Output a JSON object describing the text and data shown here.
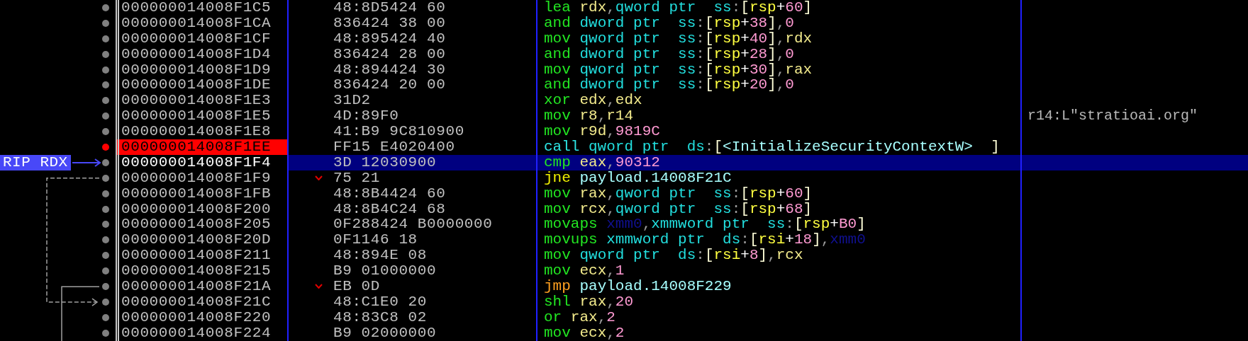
{
  "rows": [
    {
      "address": "000000014008F1C5",
      "bytes": "48:8D5424 60",
      "breakpoint": false,
      "selected": false,
      "jump": false,
      "instruction": [
        {
          "text": "lea ",
          "kind": "mnemonic"
        },
        {
          "text": "rdx",
          "kind": "register"
        },
        {
          "text": ",",
          "kind": "sep"
        },
        {
          "text": "qword ptr  ",
          "kind": "size"
        },
        {
          "text": "ss",
          "kind": "segment"
        },
        {
          "text": ":",
          "kind": "sep"
        },
        {
          "text": "[",
          "kind": "bracket"
        },
        {
          "text": "rsp",
          "kind": "memreg"
        },
        {
          "text": "+",
          "kind": "op"
        },
        {
          "text": "60",
          "kind": "number"
        },
        {
          "text": "]",
          "kind": "bracket"
        }
      ]
    },
    {
      "address": "000000014008F1CA",
      "bytes": "836424 38 00",
      "breakpoint": false,
      "selected": false,
      "jump": false,
      "instruction": [
        {
          "text": "and ",
          "kind": "mnemonic"
        },
        {
          "text": "dword ptr  ",
          "kind": "size"
        },
        {
          "text": "ss",
          "kind": "segment"
        },
        {
          "text": ":",
          "kind": "sep"
        },
        {
          "text": "[",
          "kind": "bracket"
        },
        {
          "text": "rsp",
          "kind": "memreg"
        },
        {
          "text": "+",
          "kind": "op"
        },
        {
          "text": "38",
          "kind": "number"
        },
        {
          "text": "]",
          "kind": "bracket"
        },
        {
          "text": ",",
          "kind": "sep"
        },
        {
          "text": "0",
          "kind": "number"
        }
      ]
    },
    {
      "address": "000000014008F1CF",
      "bytes": "48:895424 40",
      "breakpoint": false,
      "selected": false,
      "jump": false,
      "instruction": [
        {
          "text": "mov ",
          "kind": "mnemonic"
        },
        {
          "text": "qword ptr  ",
          "kind": "size"
        },
        {
          "text": "ss",
          "kind": "segment"
        },
        {
          "text": ":",
          "kind": "sep"
        },
        {
          "text": "[",
          "kind": "bracket"
        },
        {
          "text": "rsp",
          "kind": "memreg"
        },
        {
          "text": "+",
          "kind": "op"
        },
        {
          "text": "40",
          "kind": "number"
        },
        {
          "text": "]",
          "kind": "bracket"
        },
        {
          "text": ",",
          "kind": "sep"
        },
        {
          "text": "rdx",
          "kind": "register"
        }
      ]
    },
    {
      "address": "000000014008F1D4",
      "bytes": "836424 28 00",
      "breakpoint": false,
      "selected": false,
      "jump": false,
      "instruction": [
        {
          "text": "and ",
          "kind": "mnemonic"
        },
        {
          "text": "dword ptr  ",
          "kind": "size"
        },
        {
          "text": "ss",
          "kind": "segment"
        },
        {
          "text": ":",
          "kind": "sep"
        },
        {
          "text": "[",
          "kind": "bracket"
        },
        {
          "text": "rsp",
          "kind": "memreg"
        },
        {
          "text": "+",
          "kind": "op"
        },
        {
          "text": "28",
          "kind": "number"
        },
        {
          "text": "]",
          "kind": "bracket"
        },
        {
          "text": ",",
          "kind": "sep"
        },
        {
          "text": "0",
          "kind": "number"
        }
      ]
    },
    {
      "address": "000000014008F1D9",
      "bytes": "48:894424 30",
      "breakpoint": false,
      "selected": false,
      "jump": false,
      "instruction": [
        {
          "text": "mov ",
          "kind": "mnemonic"
        },
        {
          "text": "qword ptr  ",
          "kind": "size"
        },
        {
          "text": "ss",
          "kind": "segment"
        },
        {
          "text": ":",
          "kind": "sep"
        },
        {
          "text": "[",
          "kind": "bracket"
        },
        {
          "text": "rsp",
          "kind": "memreg"
        },
        {
          "text": "+",
          "kind": "op"
        },
        {
          "text": "30",
          "kind": "number"
        },
        {
          "text": "]",
          "kind": "bracket"
        },
        {
          "text": ",",
          "kind": "sep"
        },
        {
          "text": "rax",
          "kind": "register"
        }
      ]
    },
    {
      "address": "000000014008F1DE",
      "bytes": "836424 20 00",
      "breakpoint": false,
      "selected": false,
      "jump": false,
      "instruction": [
        {
          "text": "and ",
          "kind": "mnemonic"
        },
        {
          "text": "dword ptr  ",
          "kind": "size"
        },
        {
          "text": "ss",
          "kind": "segment"
        },
        {
          "text": ":",
          "kind": "sep"
        },
        {
          "text": "[",
          "kind": "bracket"
        },
        {
          "text": "rsp",
          "kind": "memreg"
        },
        {
          "text": "+",
          "kind": "op"
        },
        {
          "text": "20",
          "kind": "number"
        },
        {
          "text": "]",
          "kind": "bracket"
        },
        {
          "text": ",",
          "kind": "sep"
        },
        {
          "text": "0",
          "kind": "number"
        }
      ]
    },
    {
      "address": "000000014008F1E3",
      "bytes": "31D2",
      "breakpoint": false,
      "selected": false,
      "jump": false,
      "instruction": [
        {
          "text": "xor ",
          "kind": "mnemonic"
        },
        {
          "text": "edx",
          "kind": "register"
        },
        {
          "text": ",",
          "kind": "sep"
        },
        {
          "text": "edx",
          "kind": "register"
        }
      ]
    },
    {
      "address": "000000014008F1E5",
      "bytes": "4D:89F0",
      "breakpoint": false,
      "selected": false,
      "jump": false,
      "instruction": [
        {
          "text": "mov ",
          "kind": "mnemonic"
        },
        {
          "text": "r8",
          "kind": "register"
        },
        {
          "text": ",",
          "kind": "sep"
        },
        {
          "text": "r14",
          "kind": "register"
        }
      ],
      "comment": "r14:L\"stratioai.org\""
    },
    {
      "address": "000000014008F1E8",
      "bytes": "41:B9 9C810900",
      "breakpoint": false,
      "selected": false,
      "jump": false,
      "instruction": [
        {
          "text": "mov ",
          "kind": "mnemonic"
        },
        {
          "text": "r9d",
          "kind": "register"
        },
        {
          "text": ",",
          "kind": "sep"
        },
        {
          "text": "9819C",
          "kind": "number"
        }
      ]
    },
    {
      "address": "000000014008F1EE",
      "bytes": "FF15 E4020400",
      "breakpoint": true,
      "selected": false,
      "jump": false,
      "instruction": [
        {
          "text": "call ",
          "kind": "call"
        },
        {
          "text": "qword ptr  ",
          "kind": "size"
        },
        {
          "text": "ds",
          "kind": "segment"
        },
        {
          "text": ":",
          "kind": "sep"
        },
        {
          "text": "[",
          "kind": "bracket"
        },
        {
          "text": "<InitializeSecurityContextW>  ",
          "kind": "label"
        },
        {
          "text": "]",
          "kind": "bracket"
        }
      ]
    },
    {
      "address": "000000014008F1F4",
      "bytes": "3D 12030900",
      "breakpoint": false,
      "selected": true,
      "jump": false,
      "register_label": "RIP RDX",
      "instruction": [
        {
          "text": "cmp ",
          "kind": "mnemonic"
        },
        {
          "text": "eax",
          "kind": "register"
        },
        {
          "text": ",",
          "kind": "sep"
        },
        {
          "text": "90312",
          "kind": "number"
        }
      ]
    },
    {
      "address": "000000014008F1F9",
      "bytes": "75 21",
      "breakpoint": false,
      "selected": false,
      "jump": true,
      "instruction": [
        {
          "text": "jne ",
          "kind": "jcc"
        },
        {
          "text": "payload.14008F21C",
          "kind": "label"
        }
      ]
    },
    {
      "address": "000000014008F1FB",
      "bytes": "48:8B4424 60",
      "breakpoint": false,
      "selected": false,
      "jump": false,
      "instruction": [
        {
          "text": "mov ",
          "kind": "mnemonic"
        },
        {
          "text": "rax",
          "kind": "register"
        },
        {
          "text": ",",
          "kind": "sep"
        },
        {
          "text": "qword ptr  ",
          "kind": "size"
        },
        {
          "text": "ss",
          "kind": "segment"
        },
        {
          "text": ":",
          "kind": "sep"
        },
        {
          "text": "[",
          "kind": "bracket"
        },
        {
          "text": "rsp",
          "kind": "memreg"
        },
        {
          "text": "+",
          "kind": "op"
        },
        {
          "text": "60",
          "kind": "number"
        },
        {
          "text": "]",
          "kind": "bracket"
        }
      ]
    },
    {
      "address": "000000014008F200",
      "bytes": "48:8B4C24 68",
      "breakpoint": false,
      "selected": false,
      "jump": false,
      "instruction": [
        {
          "text": "mov ",
          "kind": "mnemonic"
        },
        {
          "text": "rcx",
          "kind": "register"
        },
        {
          "text": ",",
          "kind": "sep"
        },
        {
          "text": "qword ptr  ",
          "kind": "size"
        },
        {
          "text": "ss",
          "kind": "segment"
        },
        {
          "text": ":",
          "kind": "sep"
        },
        {
          "text": "[",
          "kind": "bracket"
        },
        {
          "text": "rsp",
          "kind": "memreg"
        },
        {
          "text": "+",
          "kind": "op"
        },
        {
          "text": "68",
          "kind": "number"
        },
        {
          "text": "]",
          "kind": "bracket"
        }
      ]
    },
    {
      "address": "000000014008F205",
      "bytes": "0F288424 B0000000",
      "breakpoint": false,
      "selected": false,
      "jump": false,
      "instruction": [
        {
          "text": "movaps ",
          "kind": "mnemonic"
        },
        {
          "text": "xmm0",
          "kind": "xmm"
        },
        {
          "text": ",",
          "kind": "sep"
        },
        {
          "text": "xmmword ptr  ",
          "kind": "size"
        },
        {
          "text": "ss",
          "kind": "segment"
        },
        {
          "text": ":",
          "kind": "sep"
        },
        {
          "text": "[",
          "kind": "bracket"
        },
        {
          "text": "rsp",
          "kind": "memreg"
        },
        {
          "text": "+",
          "kind": "op"
        },
        {
          "text": "B0",
          "kind": "number"
        },
        {
          "text": "]",
          "kind": "bracket"
        }
      ]
    },
    {
      "address": "000000014008F20D",
      "bytes": "0F1146 18",
      "breakpoint": false,
      "selected": false,
      "jump": false,
      "instruction": [
        {
          "text": "movups ",
          "kind": "mnemonic"
        },
        {
          "text": "xmmword ptr  ",
          "kind": "size"
        },
        {
          "text": "ds",
          "kind": "segment"
        },
        {
          "text": ":",
          "kind": "sep"
        },
        {
          "text": "[",
          "kind": "bracket"
        },
        {
          "text": "rsi",
          "kind": "memreg"
        },
        {
          "text": "+",
          "kind": "op"
        },
        {
          "text": "18",
          "kind": "number"
        },
        {
          "text": "]",
          "kind": "bracket"
        },
        {
          "text": ",",
          "kind": "sep"
        },
        {
          "text": "xmm0",
          "kind": "xmm"
        }
      ]
    },
    {
      "address": "000000014008F211",
      "bytes": "48:894E 08",
      "breakpoint": false,
      "selected": false,
      "jump": false,
      "instruction": [
        {
          "text": "mov ",
          "kind": "mnemonic"
        },
        {
          "text": "qword ptr  ",
          "kind": "size"
        },
        {
          "text": "ds",
          "kind": "segment"
        },
        {
          "text": ":",
          "kind": "sep"
        },
        {
          "text": "[",
          "kind": "bracket"
        },
        {
          "text": "rsi",
          "kind": "memreg"
        },
        {
          "text": "+",
          "kind": "op"
        },
        {
          "text": "8",
          "kind": "number"
        },
        {
          "text": "]",
          "kind": "bracket"
        },
        {
          "text": ",",
          "kind": "sep"
        },
        {
          "text": "rcx",
          "kind": "register"
        }
      ]
    },
    {
      "address": "000000014008F215",
      "bytes": "B9 01000000",
      "breakpoint": false,
      "selected": false,
      "jump": false,
      "instruction": [
        {
          "text": "mov ",
          "kind": "mnemonic"
        },
        {
          "text": "ecx",
          "kind": "register"
        },
        {
          "text": ",",
          "kind": "sep"
        },
        {
          "text": "1",
          "kind": "number"
        }
      ]
    },
    {
      "address": "000000014008F21A",
      "bytes": "EB 0D",
      "breakpoint": false,
      "selected": false,
      "jump": true,
      "instruction": [
        {
          "text": "jmp ",
          "kind": "jmp"
        },
        {
          "text": "payload.14008F229",
          "kind": "label"
        }
      ]
    },
    {
      "address": "000000014008F21C",
      "bytes": "48:C1E0 20",
      "breakpoint": false,
      "selected": false,
      "jump": false,
      "instruction": [
        {
          "text": "shl ",
          "kind": "mnemonic"
        },
        {
          "text": "rax",
          "kind": "register"
        },
        {
          "text": ",",
          "kind": "sep"
        },
        {
          "text": "20",
          "kind": "number"
        }
      ]
    },
    {
      "address": "000000014008F220",
      "bytes": "48:83C8 02",
      "breakpoint": false,
      "selected": false,
      "jump": false,
      "instruction": [
        {
          "text": "or ",
          "kind": "mnemonic"
        },
        {
          "text": "rax",
          "kind": "register"
        },
        {
          "text": ",",
          "kind": "sep"
        },
        {
          "text": "2",
          "kind": "number"
        }
      ]
    },
    {
      "address": "000000014008F224",
      "bytes": "B9 02000000",
      "breakpoint": false,
      "selected": false,
      "jump": false,
      "instruction": [
        {
          "text": "mov ",
          "kind": "mnemonic"
        },
        {
          "text": "ecx",
          "kind": "register"
        },
        {
          "text": ",",
          "kind": "sep"
        },
        {
          "text": "2",
          "kind": "number"
        }
      ]
    }
  ]
}
